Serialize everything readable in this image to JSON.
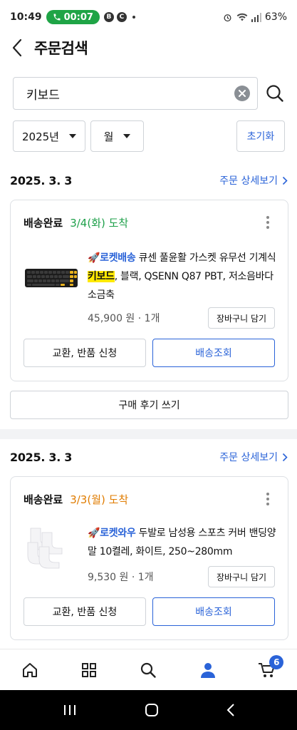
{
  "status_bar": {
    "time": "10:49",
    "call_timer": "00:07",
    "battery": "63%"
  },
  "header": {
    "title": "주문검색"
  },
  "search": {
    "value": "키보드"
  },
  "filters": {
    "year": "2025년",
    "month": "월",
    "reset_label": "초기화"
  },
  "orders": [
    {
      "date": "2025. 3. 3",
      "detail_label": "주문 상세보기",
      "status": "배송완료",
      "arrival": "3/4(화) 도착",
      "badge": "로켓배송",
      "title_pre": "큐센 풀윤활 가스켓 유무선 기계식 ",
      "title_highlight": "키보드",
      "title_post": ", 블랙, QSENN Q87 PBT, 저소음바다소금축",
      "price": "45,900 원 · 1개",
      "cart_label": "장바구니 담기",
      "exchange_label": "교환, 반품 신청",
      "tracking_label": "배송조회",
      "review_label": "구매 후기 쓰기"
    },
    {
      "date": "2025. 3. 3",
      "detail_label": "주문 상세보기",
      "status": "배송완료",
      "arrival": "3/3(월) 도착",
      "badge": "로켓와우",
      "title": "두발로 남성용 스포츠 커버 밴딩양말 10켤레, 화이트, 250~280mm",
      "price": "9,530 원 · 1개",
      "cart_label": "장바구니 담기",
      "exchange_label": "교환, 반품 신청",
      "tracking_label": "배송조회"
    }
  ],
  "bottom_nav": {
    "cart_count": "6"
  },
  "colors": {
    "accent_blue": "#2a63d8",
    "green": "#1ea04a",
    "orange": "#e07c00",
    "highlight": "#ffe900"
  }
}
